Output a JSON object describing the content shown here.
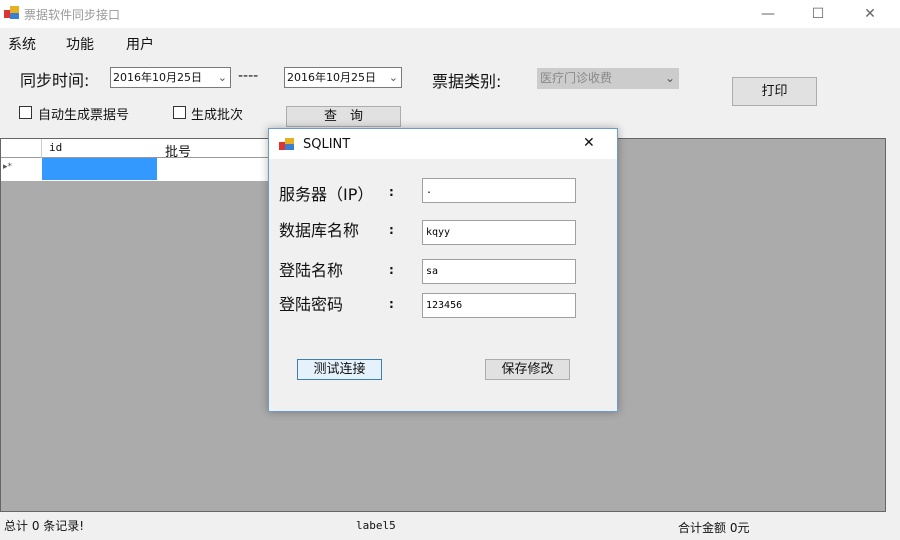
{
  "window": {
    "title": "票据软件同步接口",
    "minimize": "—",
    "maximize": "☐",
    "close": "✕"
  },
  "menu": [
    "系统",
    "功能",
    "用户"
  ],
  "toolbar": {
    "sync_time_label": "同步时间:",
    "date_from": "2016年10月25日",
    "separator": "----",
    "date_to": "2016年10月25日",
    "category_label": "票据类别:",
    "category_value": "医疗门诊收费",
    "print_button": "打印",
    "auto_gen_checkbox": "自动生成票据号",
    "gen_batch_checkbox": "生成批次",
    "query_button": "查　询"
  },
  "grid": {
    "columns": [
      "id",
      "批号"
    ],
    "row_marker": "▸*"
  },
  "dialog": {
    "title": "SQLINT",
    "close": "✕",
    "fields": [
      {
        "label": "服务器（IP）",
        "value": "."
      },
      {
        "label": "数据库名称",
        "value": "kqyy"
      },
      {
        "label": "登陆名称",
        "value": "sa"
      },
      {
        "label": "登陆密码",
        "value": "123456"
      }
    ],
    "colon": ":",
    "test_button": "测试连接",
    "save_button": "保存修改"
  },
  "status": {
    "total": "总计 0 条记录!",
    "label5": "label5",
    "amount": "合计金额 0元"
  }
}
